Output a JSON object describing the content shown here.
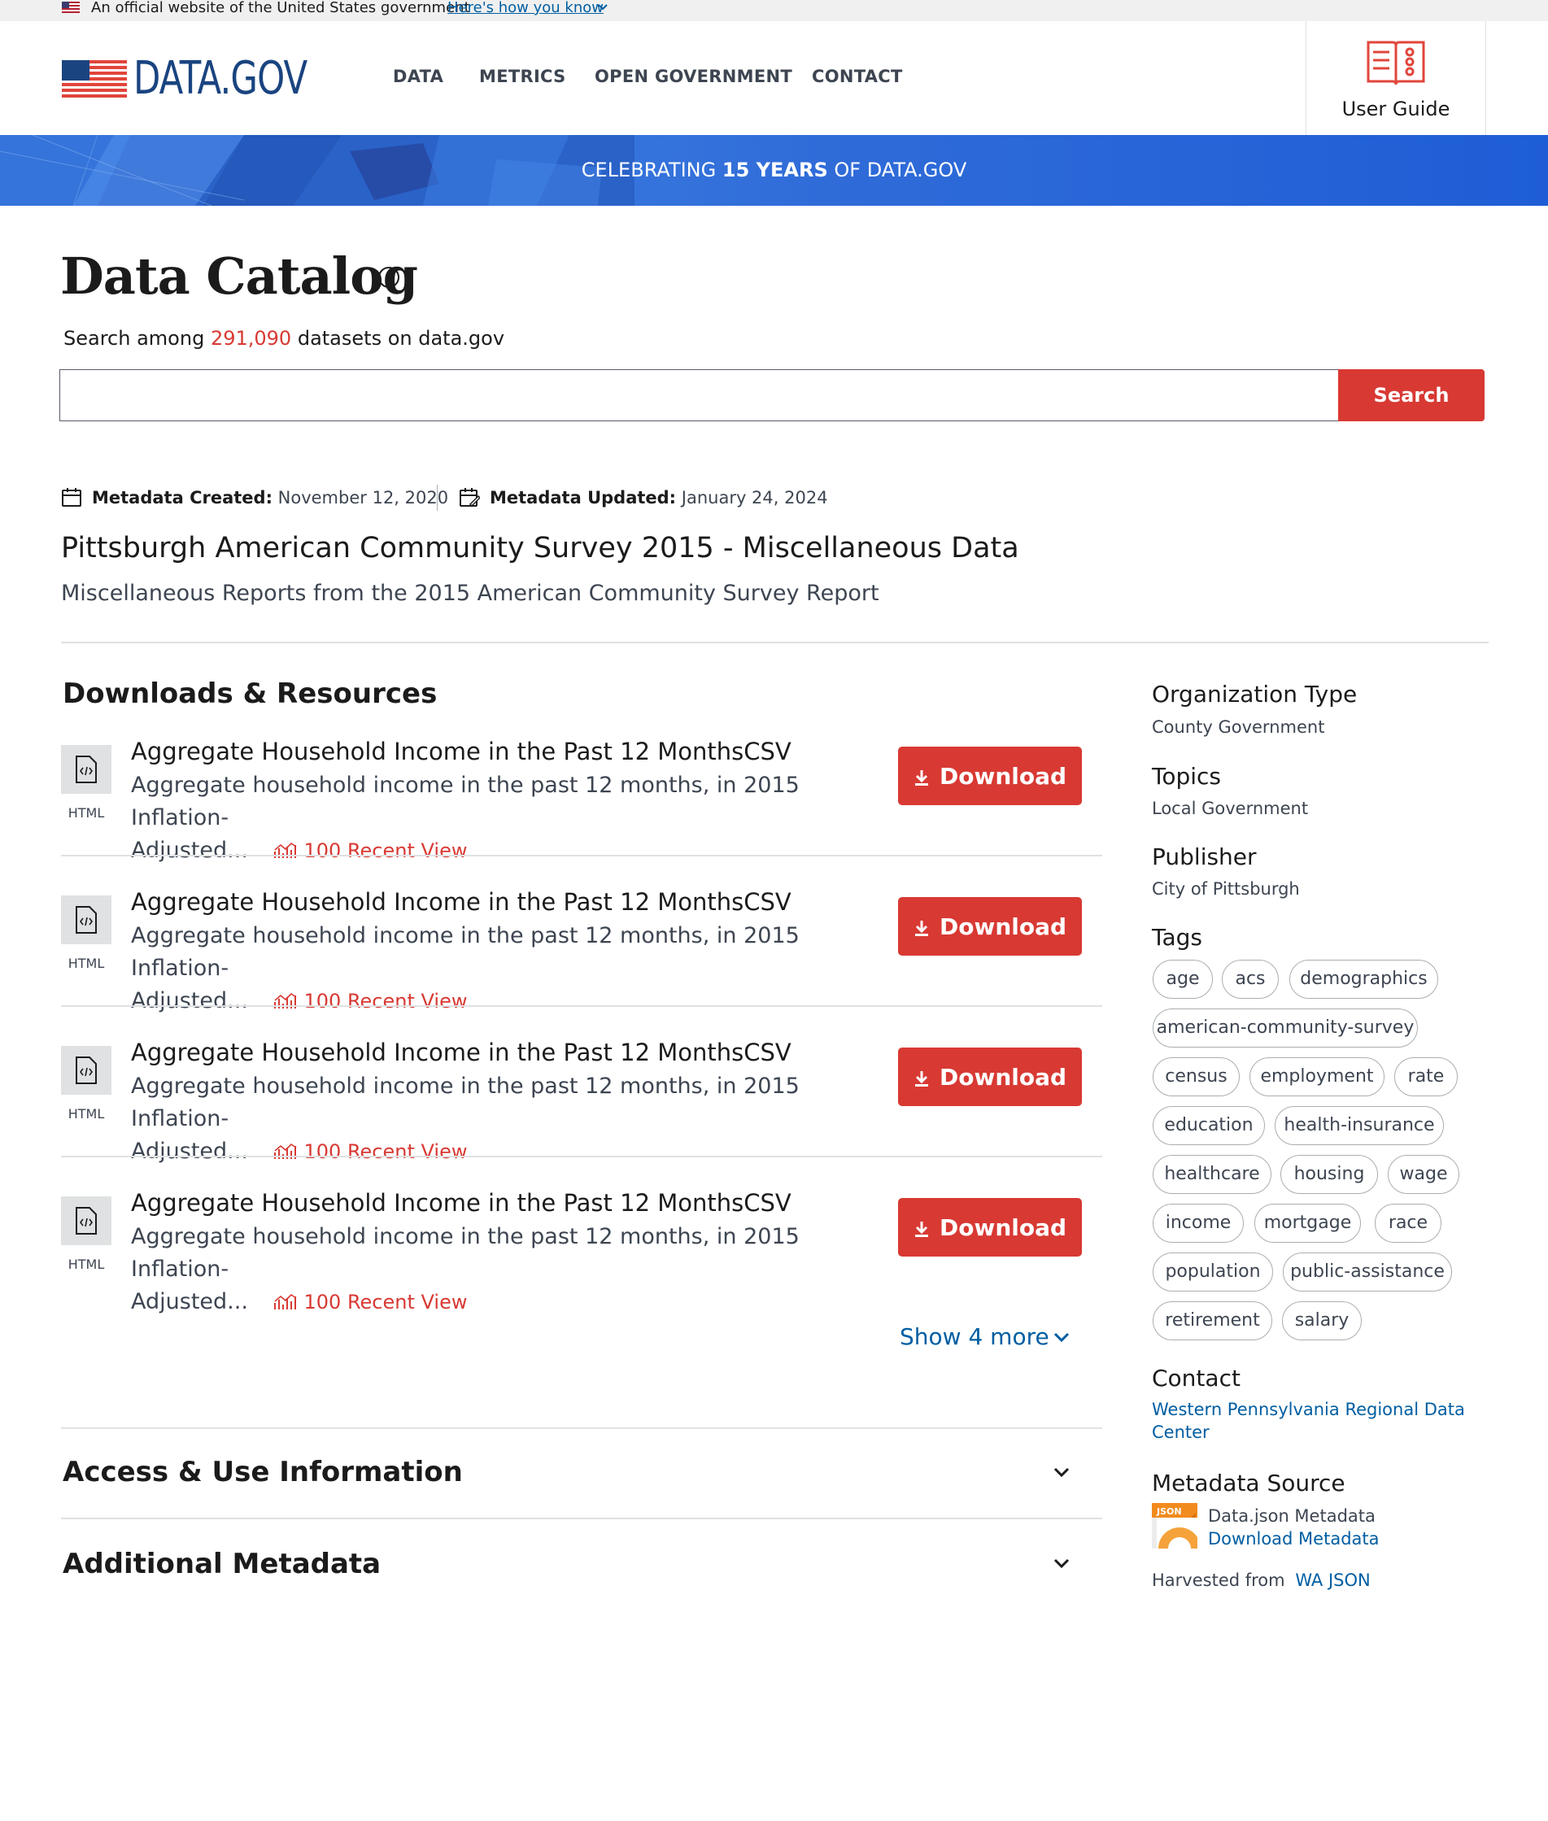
{
  "gov_banner": {
    "text": "An official website of the United States government",
    "link": "Here's how you know"
  },
  "header": {
    "logo_text": "DATA.GOV",
    "nav": [
      "DATA",
      "METRICS",
      "OPEN GOVERNMENT",
      "CONTACT"
    ],
    "user_guide": "User Guide"
  },
  "celebrate": {
    "prefix": "CELEBRATING",
    "bold": "15 YEARS",
    "suffix": "OF DATA.GOV"
  },
  "catalog": {
    "title": "Data Catalog",
    "search_prefix": "Search among",
    "dataset_count": "291,090",
    "search_suffix": "datasets on data.gov",
    "search_placeholder": "",
    "search_button": "Search"
  },
  "metadata": {
    "created_label": "Metadata Created:",
    "created_value": "November 12, 2020",
    "updated_label": "Metadata Updated:",
    "updated_value": "January 24, 2024"
  },
  "dataset": {
    "title": "Pittsburgh American Community Survey 2015 - Miscellaneous Data",
    "description": "Miscellaneous Reports from the 2015 American Community Survey Report"
  },
  "downloads": {
    "heading": "Downloads & Resources",
    "resources": [
      {
        "format": "HTML",
        "title": "Aggregate Household Income in the Past 12 MonthsCSV",
        "desc_line1": "Aggregate household income in the past 12 months, in 2015 Inflation-",
        "desc_line2": "Adjusted...",
        "views": "100 Recent View",
        "button": "Download"
      },
      {
        "format": "HTML",
        "title": "Aggregate Household Income in the Past 12 MonthsCSV",
        "desc_line1": "Aggregate household income in the past 12 months, in 2015 Inflation-",
        "desc_line2": "Adjusted...",
        "views": "100 Recent View",
        "button": "Download"
      },
      {
        "format": "HTML",
        "title": "Aggregate Household Income in the Past 12 MonthsCSV",
        "desc_line1": "Aggregate household income in the past 12 months, in 2015 Inflation-",
        "desc_line2": "Adjusted...",
        "views": "100 Recent View",
        "button": "Download"
      },
      {
        "format": "HTML",
        "title": "Aggregate Household Income in the Past 12 MonthsCSV",
        "desc_line1": "Aggregate household income in the past 12 months, in 2015 Inflation-",
        "desc_line2": "Adjusted...",
        "views": "100 Recent View",
        "button": "Download"
      }
    ],
    "show_more": "Show 4 more"
  },
  "accordions": {
    "access": "Access & Use Information",
    "additional": "Additional Metadata"
  },
  "sidebar": {
    "org_type_label": "Organization Type",
    "org_type_value": "County Government",
    "topics_label": "Topics",
    "topics_value": "Local Government",
    "publisher_label": "Publisher",
    "publisher_value": "City of Pittsburgh",
    "tags_label": "Tags",
    "tags": [
      "age",
      "acs",
      "demographics",
      "american-community-survey",
      "census",
      "employment",
      "rate",
      "education",
      "health-insurance",
      "healthcare",
      "housing",
      "wage",
      "income",
      "mortgage",
      "race",
      "population",
      "public-assistance",
      "retirement",
      "salary"
    ],
    "contact_label": "Contact",
    "contact_line1": "Western Pennsylvania Regional Data",
    "contact_line2": "Center",
    "metadata_source_label": "Metadata Source",
    "json_badge": "JSON",
    "metadata_source_value": "Data.json Metadata",
    "download_metadata": "Download Metadata",
    "harvested_label": "Harvested from",
    "harvested_link": "WA JSON"
  },
  "colors": {
    "accent_red": "#d83933",
    "link_blue": "#005ea2",
    "banner_blue": "#2f6bd8",
    "logo_blue": "#1a4480"
  }
}
